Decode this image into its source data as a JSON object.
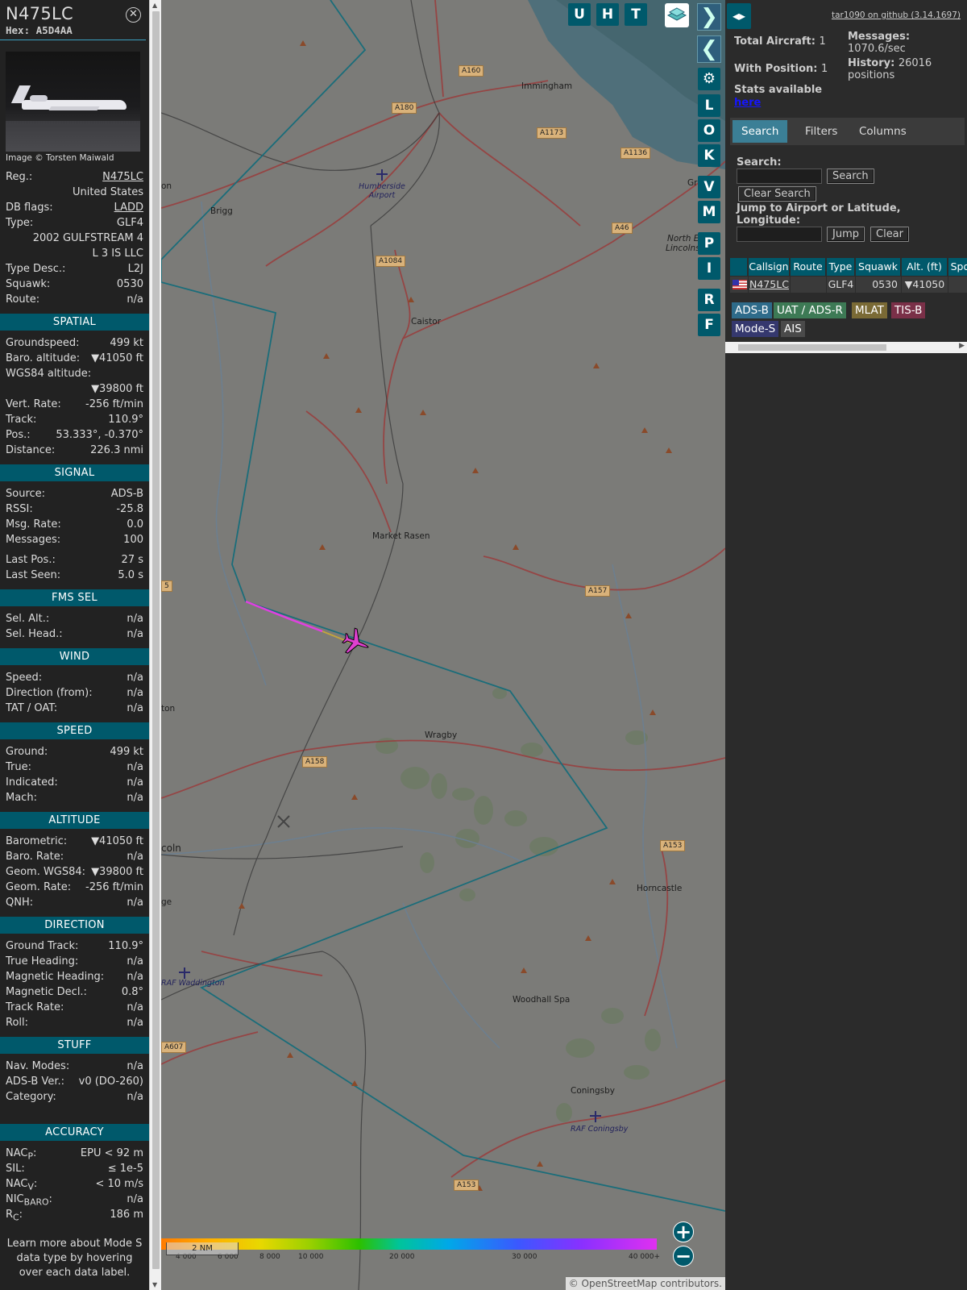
{
  "aircraft": {
    "callsign": "N475LC",
    "hex_label": "Hex:",
    "hex": "A5D4AA",
    "photo_credit": "Image © Torsten Maiwald",
    "reg_label": "Reg.:",
    "reg": "N475LC",
    "country": "United States",
    "db_flags_label": "DB flags:",
    "db_flags": "LADD",
    "type_label": "Type:",
    "type": "GLF4",
    "model": "2002 GULFSTREAM 4",
    "owner": "L 3 IS LLC",
    "type_desc_label": "Type Desc.:",
    "type_desc": "L2J",
    "squawk_label": "Squawk:",
    "squawk": "0530",
    "route_label": "Route:",
    "route": "n/a"
  },
  "spatial": {
    "title": "SPATIAL",
    "groundspeed_label": "Groundspeed:",
    "groundspeed": "499 kt",
    "baro_alt_label": "Baro. altitude:",
    "baro_alt": "▼41050 ft",
    "wgs84_label": "WGS84 altitude:",
    "wgs84": "▼39800 ft",
    "vert_rate_label": "Vert. Rate:",
    "vert_rate": "-256 ft/min",
    "track_label": "Track:",
    "track": "110.9°",
    "pos_label": "Pos.:",
    "pos": "53.333°, -0.370°",
    "distance_label": "Distance:",
    "distance": "226.3 nmi"
  },
  "signal": {
    "title": "SIGNAL",
    "source_label": "Source:",
    "source": "ADS-B",
    "rssi_label": "RSSI:",
    "rssi": "-25.8",
    "msg_rate_label": "Msg. Rate:",
    "msg_rate": "0.0",
    "messages_label": "Messages:",
    "messages": "100",
    "last_pos_label": "Last Pos.:",
    "last_pos": "27 s",
    "last_seen_label": "Last Seen:",
    "last_seen": "5.0 s"
  },
  "fms": {
    "title": "FMS SEL",
    "sel_alt_label": "Sel. Alt.:",
    "sel_alt": "n/a",
    "sel_head_label": "Sel. Head.:",
    "sel_head": "n/a"
  },
  "wind": {
    "title": "WIND",
    "speed_label": "Speed:",
    "speed": "n/a",
    "dir_label": "Direction (from):",
    "dir": "n/a",
    "tat_label": "TAT / OAT:",
    "tat": "n/a"
  },
  "speed": {
    "title": "SPEED",
    "ground_label": "Ground:",
    "ground": "499 kt",
    "true_label": "True:",
    "true_val": "n/a",
    "indicated_label": "Indicated:",
    "indicated": "n/a",
    "mach_label": "Mach:",
    "mach": "n/a"
  },
  "altitude": {
    "title": "ALTITUDE",
    "baro_label": "Barometric:",
    "baro": "▼41050 ft",
    "baro_rate_label": "Baro. Rate:",
    "baro_rate": "n/a",
    "geom_label": "Geom. WGS84:",
    "geom": "▼39800 ft",
    "geom_rate_label": "Geom. Rate:",
    "geom_rate": "-256 ft/min",
    "qnh_label": "QNH:",
    "qnh": "n/a"
  },
  "direction": {
    "title": "DIRECTION",
    "ground_track_label": "Ground Track:",
    "ground_track": "110.9°",
    "true_heading_label": "True Heading:",
    "true_heading": "n/a",
    "mag_heading_label": "Magnetic Heading:",
    "mag_heading": "n/a",
    "mag_decl_label": "Magnetic Decl.:",
    "mag_decl": "0.8°",
    "track_rate_label": "Track Rate:",
    "track_rate": "n/a",
    "roll_label": "Roll:",
    "roll": "n/a"
  },
  "stuff": {
    "title": "STUFF",
    "nav_modes_label": "Nav. Modes:",
    "nav_modes": "n/a",
    "adsb_ver_label": "ADS-B Ver.:",
    "adsb_ver": "v0 (DO-260)",
    "category_label": "Category:",
    "category": "n/a"
  },
  "accuracy": {
    "title": "ACCURACY",
    "nacp_label": "NAC",
    "nacp_sub": "P",
    "nacp": "EPU < 92 m",
    "sil_label": "SIL:",
    "sil": "≤ 1e-5",
    "nacv_label": "NAC",
    "nacv_sub": "V",
    "nacv": "< 10 m/s",
    "nicbaro_label": "NIC",
    "nicbaro_sub": "BARO",
    "nicbaro": "n/a",
    "rc_label": "R",
    "rc_sub": "C",
    "rc": "186 m"
  },
  "learn_more": "Learn more about Mode S data type by hovering over each data label.",
  "map": {
    "towns": [
      "Immingham",
      "Brigg",
      "Caistor",
      "Market Rasen",
      "Wragby",
      "Horncastle",
      "Woodhall Spa",
      "Coningsby",
      "coln",
      "ge",
      "ton",
      "on",
      "Gri",
      "North Ea",
      "Lincolnsh"
    ],
    "roads": [
      "A160",
      "A180",
      "A1173",
      "A1136",
      "A46",
      "A1084",
      "A157",
      "A158",
      "A153",
      "A153",
      "A607",
      "5"
    ],
    "airports": [
      "Humberside Airport",
      "RAF Waddington",
      "RAF Coningsby"
    ],
    "top_buttons": [
      "U",
      "H",
      "T"
    ],
    "side_buttons": [
      "L",
      "O",
      "K",
      "V",
      "M",
      "P",
      "I",
      "R",
      "F"
    ],
    "scale": "2 NM",
    "attribution_prefix": "© OpenStreetMap",
    "attribution_suffix": " contributors.",
    "altitude_scale": [
      "4 000",
      "6 000",
      "8 000",
      "10 000",
      "20 000",
      "30 000",
      "40 000+"
    ],
    "icons": [
      "layers-icon",
      "settings-gear-icon",
      "zoom-in-icon",
      "zoom-out-icon",
      "aircraft-icon"
    ]
  },
  "sidebar": {
    "github_link": "tar1090 on github (3.14.1697)",
    "total_aircraft_label": "Total Aircraft:",
    "total_aircraft": "1",
    "with_position_label": "With Position:",
    "with_position": "1",
    "stats_label": "Stats available",
    "stats_link": "here",
    "messages_label": "Messages:",
    "messages": "1070.6/sec",
    "history_label": "History:",
    "history": "26016 positions",
    "tabs": [
      "Search",
      "Filters",
      "Columns"
    ],
    "search_label": "Search:",
    "search_button": "Search",
    "clear_search_button": "Clear Search",
    "jump_label": "Jump to Airport or Latitude, Longitude:",
    "jump_button": "Jump",
    "clear_button": "Clear",
    "table_headers": [
      "Callsign",
      "Route",
      "Type",
      "Squawk",
      "Alt. (ft)",
      "Spd"
    ],
    "table_row": {
      "callsign": "N475LC",
      "route": "",
      "type": "GLF4",
      "squawk": "0530",
      "alt": "▼41050",
      "spd": ""
    },
    "source_badges": [
      "ADS-B",
      "UAT / ADS-R",
      "MLAT",
      "TIS-B",
      "Mode-S",
      "AIS"
    ]
  },
  "colors": {
    "accent": "#00596b",
    "track_line": "#e040e0",
    "aircraft": "#e040d0",
    "range_ring": "#1a6d7a"
  }
}
